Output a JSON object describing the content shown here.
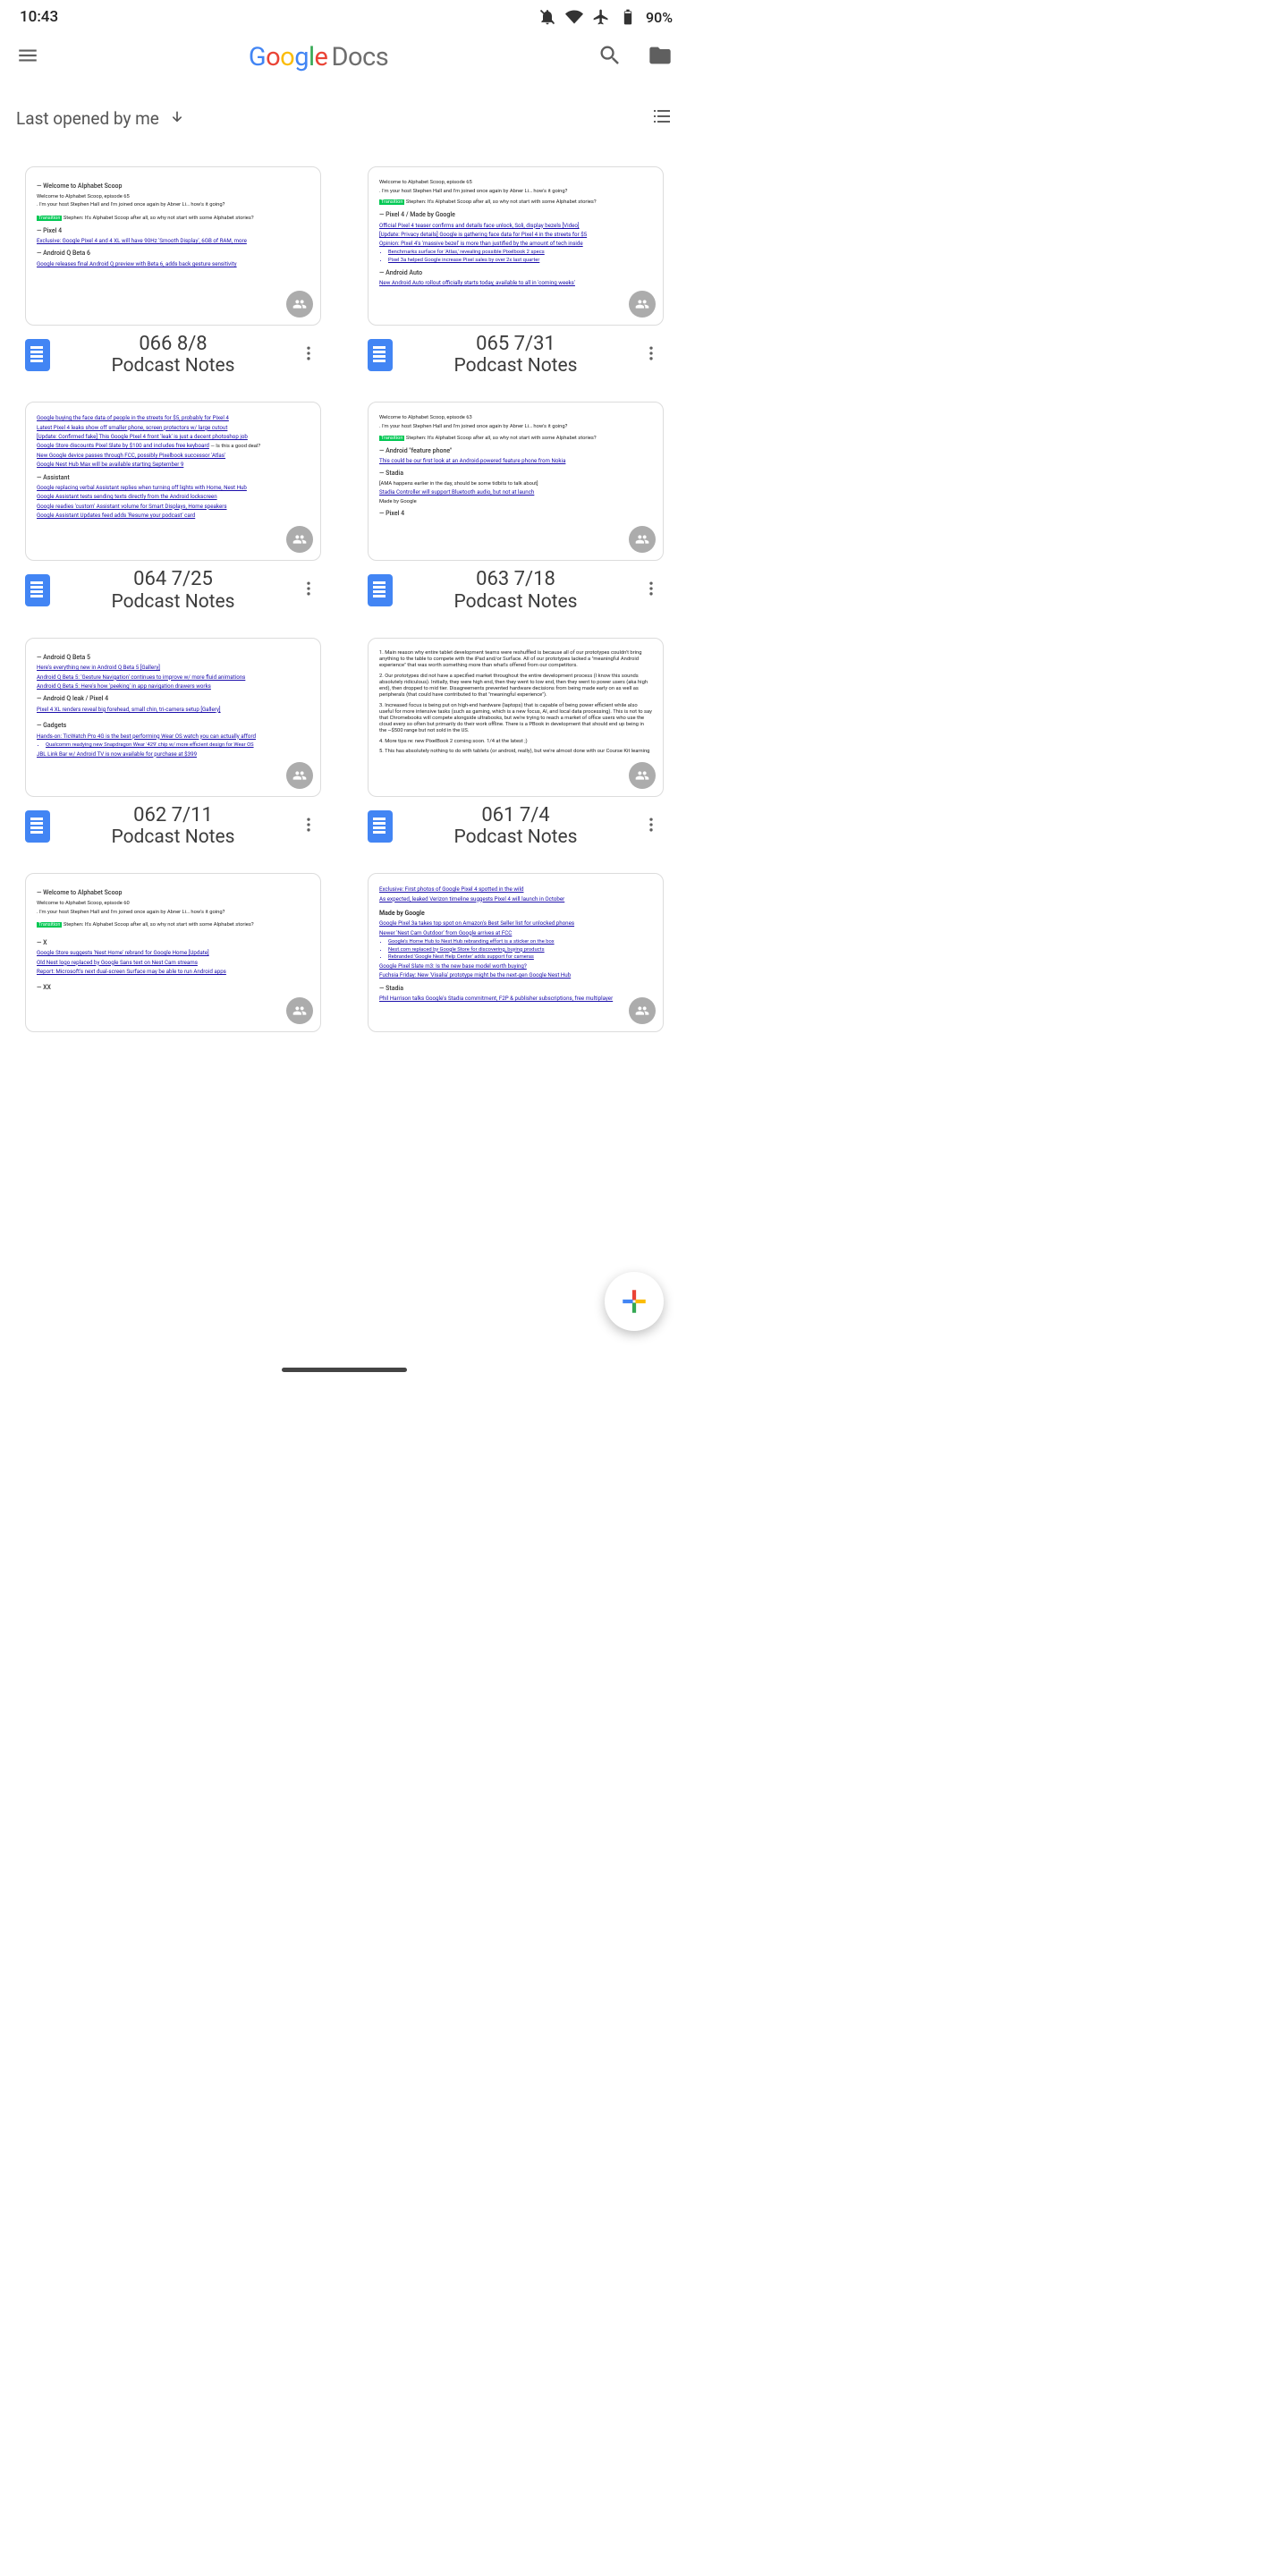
{
  "status": {
    "time": "10:43",
    "battery": "90%"
  },
  "appbar": {
    "brand_docs": "Docs"
  },
  "sort": {
    "label": "Last opened by me"
  },
  "docs": [
    {
      "line1": "066 8/8",
      "line2": "Podcast Notes"
    },
    {
      "line1": "065 7/31",
      "line2": "Podcast Notes"
    },
    {
      "line1": "064 7/25",
      "line2": "Podcast Notes"
    },
    {
      "line1": "063 7/18",
      "line2": "Podcast Notes"
    },
    {
      "line1": "062 7/11",
      "line2": "Podcast Notes"
    },
    {
      "line1": "061 7/4",
      "line2": "Podcast Notes"
    },
    {
      "line1": "",
      "line2": ""
    },
    {
      "line1": "",
      "line2": ""
    }
  ],
  "previews": {
    "0": {
      "welcome": "— Welcome to Alphabet Scoop",
      "intro": "Welcome to Alphabet Scoop, episode 65",
      "host": ". I'm your host Stephen Hall and I'm joined once again by Abner Li… how's it going?",
      "transition": "Stephen: It's Alphabet Scoop after all, so why not start with some Alphabet stories?",
      "h1": "— Pixel 4",
      "l1": "Exclusive: Google Pixel 4 and 4 XL will have 90Hz 'Smooth Display', 6GB of RAM, more",
      "h2": "— Android Q Beta 6",
      "l2": "Google releases final Android Q preview with Beta 6, adds back gesture sensitivity"
    },
    "1": {
      "intro": "Welcome to Alphabet Scoop, episode 65",
      "host": ". I'm your host Stephen Hall and I'm joined once again by Abner Li… how's it going?",
      "transition": "Stephen: It's Alphabet Scoop after all, so why not start with some Alphabet stories?",
      "h1": "— Pixel 4 / Made by Google",
      "l1": "Official Pixel 4 teaser confirms and details face unlock, Soli, display bezels [Video]",
      "l2": "[Update: Privacy details] Google is gathering face data for Pixel 4 in the streets for $5",
      "l3": "Opinion: Pixel 4's 'massive bezel' is more than justified by the amount of tech inside",
      "b1": "Benchmarks surface for 'Atlas,' revealing possible Pixelbook 2 specs",
      "b2": "Pixel 3a helped Google increase Pixel sales by over 2x last quarter",
      "h2": "— Android Auto",
      "l4": "New Android Auto rollout officially starts today, available to all in 'coming weeks'"
    },
    "2": {
      "l1": "Google buying the face data of people in the streets for $5, probably for Pixel 4",
      "l2": "Latest Pixel 4 leaks show off smaller phone, screen protectors w/ large cutout",
      "l3": "[Update: Confirmed fake] This Google Pixel 4 front 'leak' is just a decent photoshop job",
      "l4a": "Google Store discounts Pixel Slate by $100 and includes free keyboard",
      "l4b": " — Is this a good deal?",
      "l5": "New Google device passes through FCC, possibly Pixelbook successor 'Atlas'",
      "l6": "Google Nest Hub Max will be available starting September 9",
      "h1": "— Assistant",
      "l7": "Google replacing verbal Assistant replies when turning off lights with Home, Nest Hub",
      "l8": "Google Assistant tests sending texts directly from the Android lockscreen",
      "l9": "Google readies 'custom' Assistant volume for Smart Displays, Home speakers",
      "l10": "Google Assistant Updates feed adds 'Resume your podcast' card"
    },
    "3": {
      "intro": "Welcome to Alphabet Scoop, episode 63",
      "host": ". I'm your host Stephen Hall and I'm joined once again by Abner Li… how's it going?",
      "transition": "Stephen: It's Alphabet Scoop after all, so why not start with some Alphabet stories?",
      "h1": "— Android \"feature phone\"",
      "l1": "This could be our first look at an Android-powered feature phone from Nokia",
      "h2": "— Stadia",
      "t1": "[AMA happens earlier in the day, should be some tidbits to talk about]",
      "l2": "Stadia Controller will support Bluetooth audio, but not at launch",
      "t2": "Made by Google",
      "h3": "— Pixel 4"
    },
    "4": {
      "h1": "— Android Q Beta 5",
      "l1": "Here's everything new in Android Q Beta 5 [Gallery]",
      "l2": "Android Q Beta 5: 'Gesture Navigation' continues to improve w/ more fluid animations",
      "l3": "Android Q Beta 5: Here's how 'peeking' in app navigation drawers works",
      "h2": "— Android Q leak / Pixel 4",
      "l4": "Pixel 4 XL renders reveal big forehead, small chin, tri-camera setup [Gallery]",
      "h3": "— Gadgets",
      "l5": "Hands-on: TicWatch Pro 4G is the best performing Wear OS watch you can actually afford",
      "b1": "Qualcomm readying new Snapdragon Wear '429' chip w/ more efficient design for Wear OS",
      "l6": "JBL Link Bar w/ Android TV is now available for purchase at $399"
    },
    "5": {
      "p1": "1. Main reason why entire tablet development teams were reshuffled is because all of our prototypes couldn't bring anything to the table to compete with the iPad and/or Surface. All of our prototypes lacked a \"meaningful Android experience\" that was worth something more than what's offered from our competitors.",
      "p2": "2. Our prototypes did not have a specified market throughout the entire development process (I know this sounds absolutely ridiculous). Initially, they were high end, then they went to low end, then they went to power users (aka high end), then dropped to mid tier. Disagreements prevented hardware decisions from being made early on as well as peripherals (that could have contributed to that \"meaningful experience\").",
      "p3": "3. Increased focus is being put on high-end hardware (laptops) that is capable of being power efficient while also useful for more intensive tasks (such as gaming, which is a new focus, AI, and local data processing). This is not to say that Chromebooks will compete alongside ultrabooks, but we're trying to reach a market of office users who use the cloud every so often but primarily do their work offline. There is a PBook in development that should end up being in the ~$500 range but not sold in the US.",
      "p4": "4. More tips re: new PixelBook 2 coming soon. 1/4 at the latest ;)",
      "p5": "5. This has absolutely nothing to do with tablets (or android, really), but we're almost done with our Course Kit learning"
    },
    "6": {
      "welcome": "— Welcome to Alphabet Scoop",
      "intro": "Welcome to Alphabet Scoop, episode 60",
      "host": ". I'm your host Stephen Hall and I'm joined once again by Abner Li… how's it going?",
      "transition": "Stephen: It's Alphabet Scoop after all, so why not start with some Alphabet stories?",
      "h1": "— X",
      "l1": "Google Store suggests 'Nest Home' rebrand for Google Home [Update]",
      "l2": "Old Nest logo replaced by Google Sans text on Nest Cam streams",
      "l3": "Report: Microsoft's next dual-screen Surface may be able to run Android apps",
      "h2": "— XX"
    },
    "7": {
      "l1": "Exclusive: First photos of Google Pixel 4 spotted in the wild",
      "l2": "As expected, leaked Verizon timeline suggests Pixel 4 will launch in October",
      "h1": "Made by Google",
      "l3": "Google Pixel 3a takes top spot on Amazon's Best Seller list for unlocked phones",
      "l4": "Newer 'Nest Cam Outdoor' from Google arrives at FCC",
      "b1": "Google's Home Hub to Nest Hub rebranding effort is a sticker on the box",
      "b2": "Nest.com replaced by Google Store for discovering, buying products",
      "b3": "Rebranded 'Google Nest Help Center' adds support for cameras",
      "l5": "Google Pixel Slate m3: Is the new base model worth buying?",
      "l6": "Fuchsia Friday: New 'Visalia' prototype might be the next-gen Google Nest Hub",
      "h2": "— Stadia",
      "l7": "Phil Harrison talks Google's Stadia commitment, F2P & publisher subscriptions, free multiplayer"
    }
  }
}
